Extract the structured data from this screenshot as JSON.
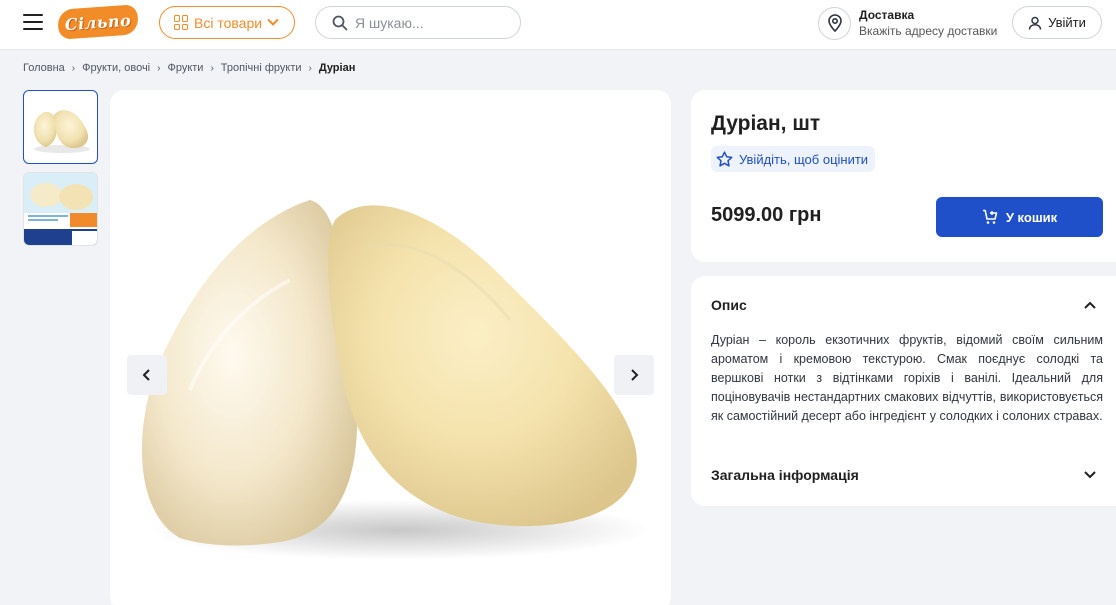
{
  "header": {
    "logo_text": "Сільпо",
    "all_goods_label": "Всі товари",
    "search_placeholder": "Я шукаю...",
    "delivery_title": "Доставка",
    "delivery_subtitle": "Вкажіть адресу доставки",
    "login_label": "Увійти"
  },
  "breadcrumbs": [
    "Головна",
    "Фрукти, овочі",
    "Фрукти",
    "Тропічні фрукти",
    "Дуріан"
  ],
  "product": {
    "title": "Дуріан, шт",
    "rate_label": "Увійдіть, щоб оцінити",
    "price": "5099.00 грн",
    "cart_label": "У кошик"
  },
  "description": {
    "heading": "Опис",
    "text": "Дуріан – король екзотичних фруктів, відомий своїм сильним ароматом і кремовою текстурою. Смак поєднує солодкі та вершкові нотки з відтінками горіхів і ванілі. Ідеальний для поціновувачів нестандартних смакових відчуттів, використовується як самостійний десерт або інгредієнт у солодких і солоних стравах."
  },
  "general_info": {
    "heading": "Загальна інформація"
  },
  "colors": {
    "brand_orange": "#f28c28",
    "primary_blue": "#1f4fc9",
    "page_bg": "#f1f3f7"
  }
}
